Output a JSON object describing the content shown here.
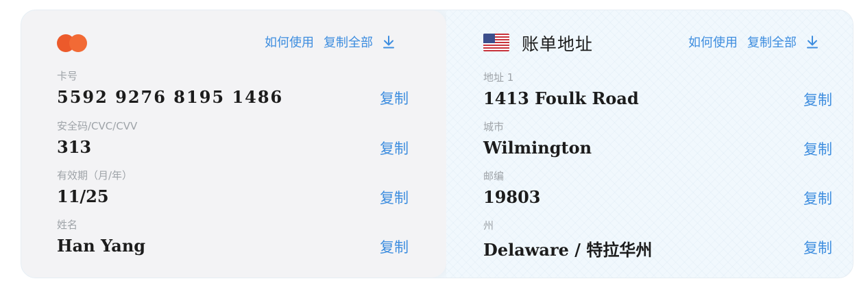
{
  "card": {
    "actions": {
      "how_to_use": "如何使用",
      "copy_all": "复制全部"
    },
    "fields": [
      {
        "label": "卡号",
        "value": "5592 9276 8195 1486",
        "copy": "复制"
      },
      {
        "label": "安全码/CVC/CVV",
        "value": "313",
        "copy": "复制"
      },
      {
        "label": "有效期（月/年）",
        "value": "11/25",
        "copy": "复制"
      },
      {
        "label": "姓名",
        "value": "Han Yang",
        "copy": "复制"
      }
    ],
    "brand_colors": [
      "#ec5a2b",
      "#f26a35"
    ]
  },
  "billing": {
    "title": "账单地址",
    "actions": {
      "how_to_use": "如何使用",
      "copy_all": "复制全部"
    },
    "fields": [
      {
        "label": "地址 1",
        "value": "1413 Foulk Road",
        "copy": "复制"
      },
      {
        "label": "城市",
        "value": "Wilmington",
        "copy": "复制"
      },
      {
        "label": "邮编",
        "value": "19803",
        "copy": "复制"
      },
      {
        "label": "州",
        "value": "Delaware / 特拉华州",
        "copy": "复制"
      }
    ]
  },
  "colors": {
    "accent": "#3d8ddf",
    "card_bg": "#f3f3f5",
    "billing_bg": "#f1f8fd"
  }
}
